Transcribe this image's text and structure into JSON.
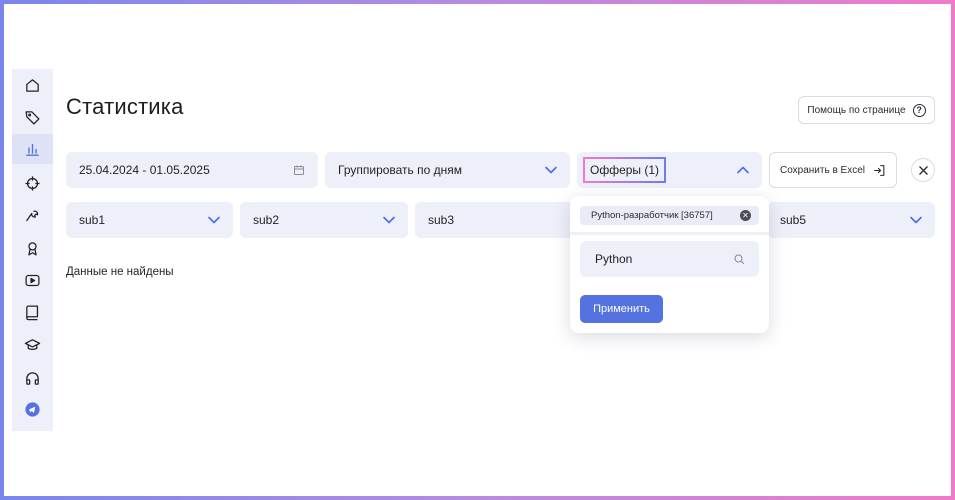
{
  "page": {
    "title": "Статистика",
    "help_label": "Помощь по странице"
  },
  "filters": {
    "date_range": "25.04.2024 - 01.05.2025",
    "group_by": "Группировать по дням",
    "offers": "Офферы (1)",
    "export_label": "Сохранить в Excel"
  },
  "subs": [
    "sub1",
    "sub2",
    "sub3",
    "sub5"
  ],
  "empty_state": "Данные не найдены",
  "offers_popup": {
    "selected_chip": "Python-разработчик [36757]",
    "search_value": "Python",
    "apply_label": "Применить"
  },
  "sidebar": {
    "items": [
      "home-icon",
      "tag-icon",
      "statistics-icon",
      "crosshair-icon",
      "tools-icon",
      "award-icon",
      "video-icon",
      "book-icon",
      "education-icon",
      "headphones-icon",
      "telegram-icon"
    ],
    "active": "statistics-icon"
  },
  "colors": {
    "accent": "#5472e0",
    "field_bg": "#eef0f9",
    "chevron": "#4a6cf0"
  }
}
